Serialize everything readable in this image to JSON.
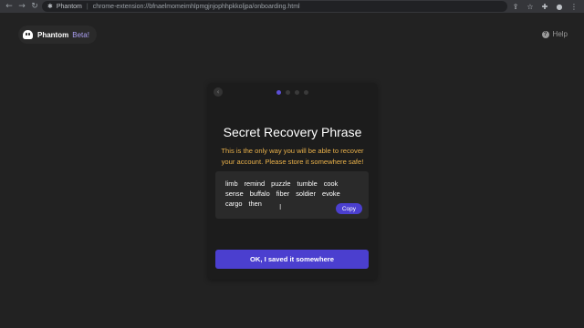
{
  "browser": {
    "tab_name": "Phantom",
    "url": "chrome-extension://bfnaelmomeimhlpmgjnjophhpkkoljpa/onboarding.html",
    "icons": {
      "back": "arrow-left-icon",
      "forward": "arrow-right-icon",
      "reload": "reload-icon",
      "extension": "puzzle-icon",
      "share": "share-icon",
      "bookmark": "star-icon",
      "extensions": "extensions-icon",
      "profile": "profile-icon",
      "menu": "menu-icon"
    }
  },
  "header": {
    "brand_name": "Phantom",
    "brand_badge": "Beta!",
    "help_label": "Help"
  },
  "card": {
    "steps": {
      "total": 4,
      "current": 1
    },
    "title": "Secret Recovery Phrase",
    "warning": "This is the only way you will be able to recover your account. Please store it somewhere safe!",
    "phrase": [
      "limb",
      "remind",
      "puzzle",
      "tumble",
      "cook",
      "sense",
      "buffalo",
      "fiber",
      "soldier",
      "evoke",
      "cargo",
      "then"
    ],
    "copy_label": "Copy",
    "confirm_label": "OK, I saved it somewhere"
  },
  "colors": {
    "background": "#222222",
    "card": "#1c1c1c",
    "accent": "#4b3fcf",
    "warning": "#e8b04a",
    "beta": "#ab9ff2"
  }
}
